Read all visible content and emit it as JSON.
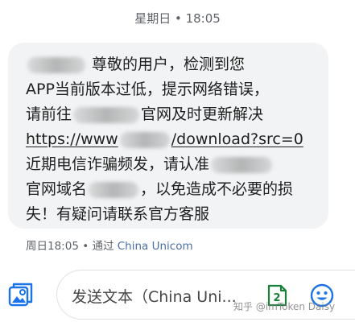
{
  "header": {
    "day_time": "星期日 • 18:05"
  },
  "message": {
    "lines": [
      {
        "before": "",
        "after": "尊敬的用户，检测到您"
      },
      {
        "before": "APP当前版本过低，提示网络错误，",
        "after": ""
      },
      {
        "before": "请前往",
        "after": "官网及时更新解决"
      },
      {
        "before": "https://www",
        "after": "/download?src=0"
      },
      {
        "before": "近期电信诈骗频发，请认准",
        "after": ""
      },
      {
        "before": "官网域名",
        "after": "，以免造成不必要的损"
      },
      {
        "before": "失！有疑问请联系官方客服",
        "after": ""
      }
    ]
  },
  "meta": {
    "time": "周日18:05",
    "separator": " • 通过 ",
    "carrier": "China Unicom"
  },
  "compose": {
    "placeholder": "发送文本（China Uni...",
    "sticker_label": "2"
  },
  "watermark": "知乎 @imToken Daisy",
  "colors": {
    "bubble": "#f1f3f4",
    "accent_blue": "#1a73e8",
    "meta_gray": "#5f6368"
  },
  "icons": {
    "attach": "gallery-attach-icon",
    "sticker": "sticker-icon",
    "emoji": "emoji-icon"
  }
}
